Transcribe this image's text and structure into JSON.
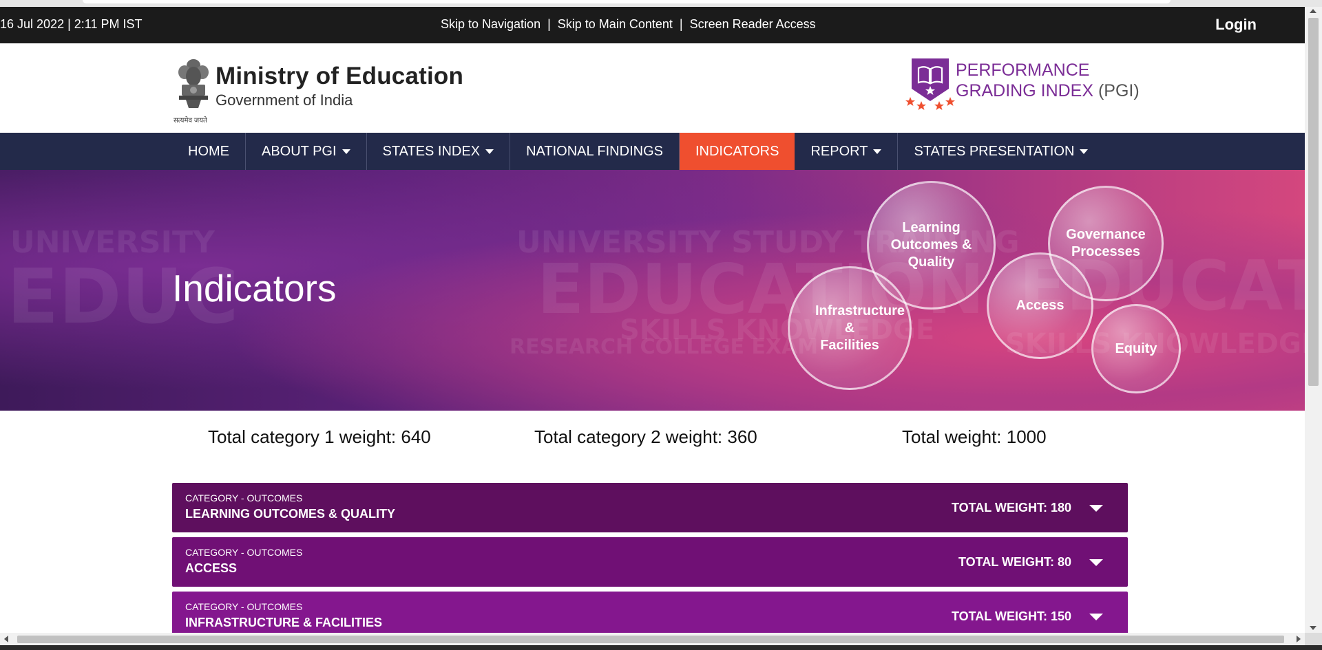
{
  "topbar": {
    "datetime": "16 Jul 2022  |  2:11 PM IST",
    "skip_navigation": "Skip to Navigation",
    "skip_main": "Skip to Main Content",
    "screen_reader": "Screen Reader Access",
    "separator": "|",
    "login": "Login"
  },
  "header": {
    "emblem_caption": "सत्यमेव जयते",
    "ministry_title": "Ministry of Education",
    "ministry_subtitle": "Government of India",
    "pgi_line1": "PERFORMANCE",
    "pgi_line2": "GRADING INDEX",
    "pgi_abbr": "(PGI)"
  },
  "nav": {
    "items": [
      {
        "label": "HOME",
        "dropdown": false
      },
      {
        "label": "ABOUT PGI",
        "dropdown": true
      },
      {
        "label": "STATES INDEX",
        "dropdown": true
      },
      {
        "label": "NATIONAL FINDINGS",
        "dropdown": false
      },
      {
        "label": "INDICATORS",
        "dropdown": false,
        "active": true
      },
      {
        "label": "REPORT",
        "dropdown": true
      },
      {
        "label": "STATES PRESENTATION",
        "dropdown": true
      }
    ]
  },
  "banner": {
    "title": "Indicators",
    "bubbles": {
      "learning": "Learning Outcomes & Quality",
      "governance": "Governance Processes",
      "infrastructure": "Infrastructure & Facilities",
      "access": "Access",
      "equity": "Equity"
    }
  },
  "weights": {
    "cat1": "Total category 1 weight: 640",
    "cat2": "Total category 2 weight: 360",
    "total": "Total weight: 1000"
  },
  "categories": [
    {
      "small": "CATEGORY - OUTCOMES",
      "name": "LEARNING OUTCOMES & QUALITY",
      "weight": "TOTAL WEIGHT: 180",
      "color": "#5e0f5e"
    },
    {
      "small": "CATEGORY - OUTCOMES",
      "name": "ACCESS",
      "weight": "TOTAL WEIGHT: 80",
      "color": "#701075"
    },
    {
      "small": "CATEGORY - OUTCOMES",
      "name": "INFRASTRUCTURE & FACILITIES",
      "weight": "TOTAL WEIGHT: 150",
      "color": "#84178e"
    }
  ],
  "colors": {
    "topbar_bg": "#1b1b1b",
    "nav_bg": "#232a4a",
    "nav_active": "#ef4f2f",
    "pgi_purple": "#7b2d96"
  }
}
